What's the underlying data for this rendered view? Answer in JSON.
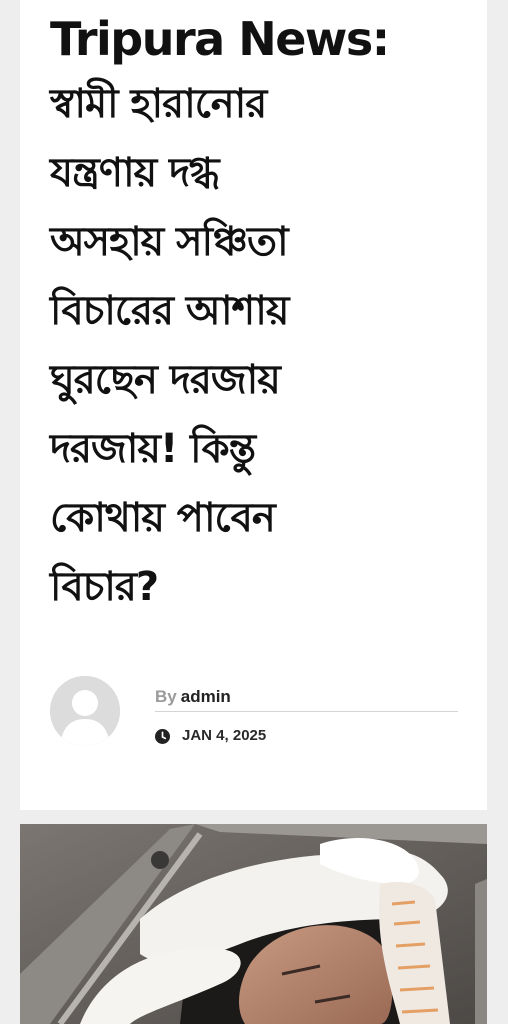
{
  "article": {
    "title_lines": [
      "Tripura News:",
      "স্বামী হারানোর",
      "যন্ত্রণায় দগ্ধ",
      "অসহায় সঞ্চিতা",
      "বিচারের আশায়",
      "ঘুরছেন দরজায়",
      "দরজায়! কিন্তু",
      "কোথায় পাবেন",
      "বিচার?"
    ],
    "by_prefix": "By",
    "author": "admin",
    "date": "JAN 4, 2025"
  },
  "icons": {
    "avatar": "user-silhouette-icon",
    "date": "clock-icon"
  },
  "colors": {
    "text": "#111111",
    "muted": "#9a9a9a",
    "page_bg": "#eeeeee",
    "card_bg": "#ffffff"
  }
}
